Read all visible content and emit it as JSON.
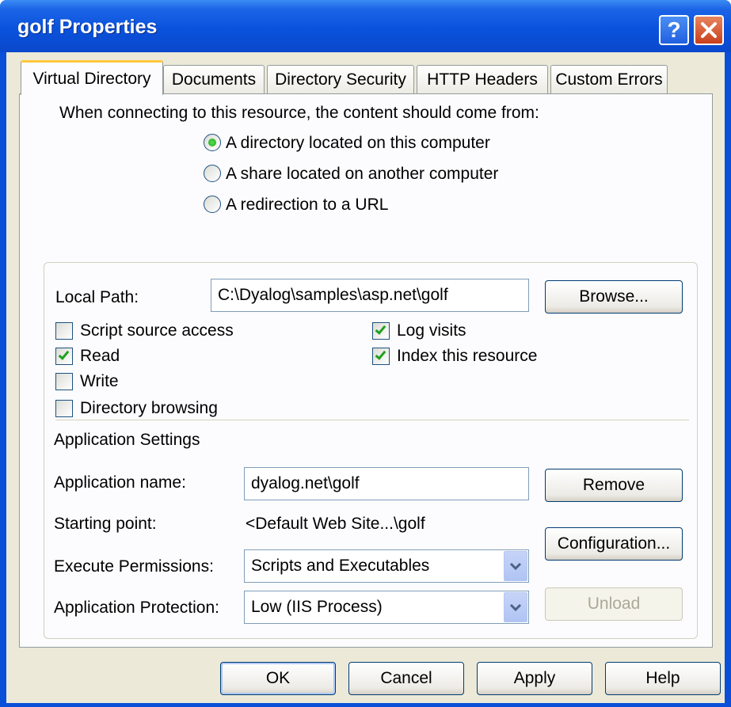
{
  "window": {
    "title": "golf Properties",
    "help_label": "?",
    "close_label": "✕"
  },
  "tabs": [
    {
      "label": "Virtual Directory",
      "active": true
    },
    {
      "label": "Documents"
    },
    {
      "label": "Directory Security"
    },
    {
      "label": "HTTP Headers"
    },
    {
      "label": "Custom Errors"
    }
  ],
  "content_source": {
    "prompt": "When connecting to this resource, the content should come from:",
    "options": [
      {
        "label": "A directory located on this computer",
        "checked": true
      },
      {
        "label": "A share located on another computer",
        "checked": false
      },
      {
        "label": "A redirection to a URL",
        "checked": false
      }
    ]
  },
  "local_path": {
    "label": "Local Path:",
    "value": "C:\\Dyalog\\samples\\asp.net\\golf",
    "browse_label": "Browse..."
  },
  "permissions": [
    {
      "label": "Script source access",
      "checked": false
    },
    {
      "label": "Read",
      "checked": true
    },
    {
      "label": "Write",
      "checked": false
    },
    {
      "label": "Directory browsing",
      "checked": false
    },
    {
      "label": "Log visits",
      "checked": true
    },
    {
      "label": "Index this resource",
      "checked": true
    }
  ],
  "app_settings": {
    "heading": "Application Settings",
    "name_label": "Application name:",
    "name_value": "dyalog.net\\golf",
    "remove_label": "Remove",
    "start_label": "Starting point:",
    "start_value": "<Default Web Site...\\golf",
    "config_label": "Configuration...",
    "exec_label": "Execute Permissions:",
    "exec_value": "Scripts and Executables",
    "protect_label": "Application Protection:",
    "protect_value": "Low (IIS Process)",
    "unload_label": "Unload"
  },
  "footer": {
    "ok": "OK",
    "cancel": "Cancel",
    "apply": "Apply",
    "help": "Help"
  },
  "colors": {
    "titlebar": "#0a52dc",
    "dialog_bg": "#ece9d8",
    "tab_accent": "#ffc83c",
    "check_green": "#21a121"
  },
  "icons": [
    "help-icon",
    "close-icon",
    "chevron-down-icon",
    "check-icon"
  ]
}
